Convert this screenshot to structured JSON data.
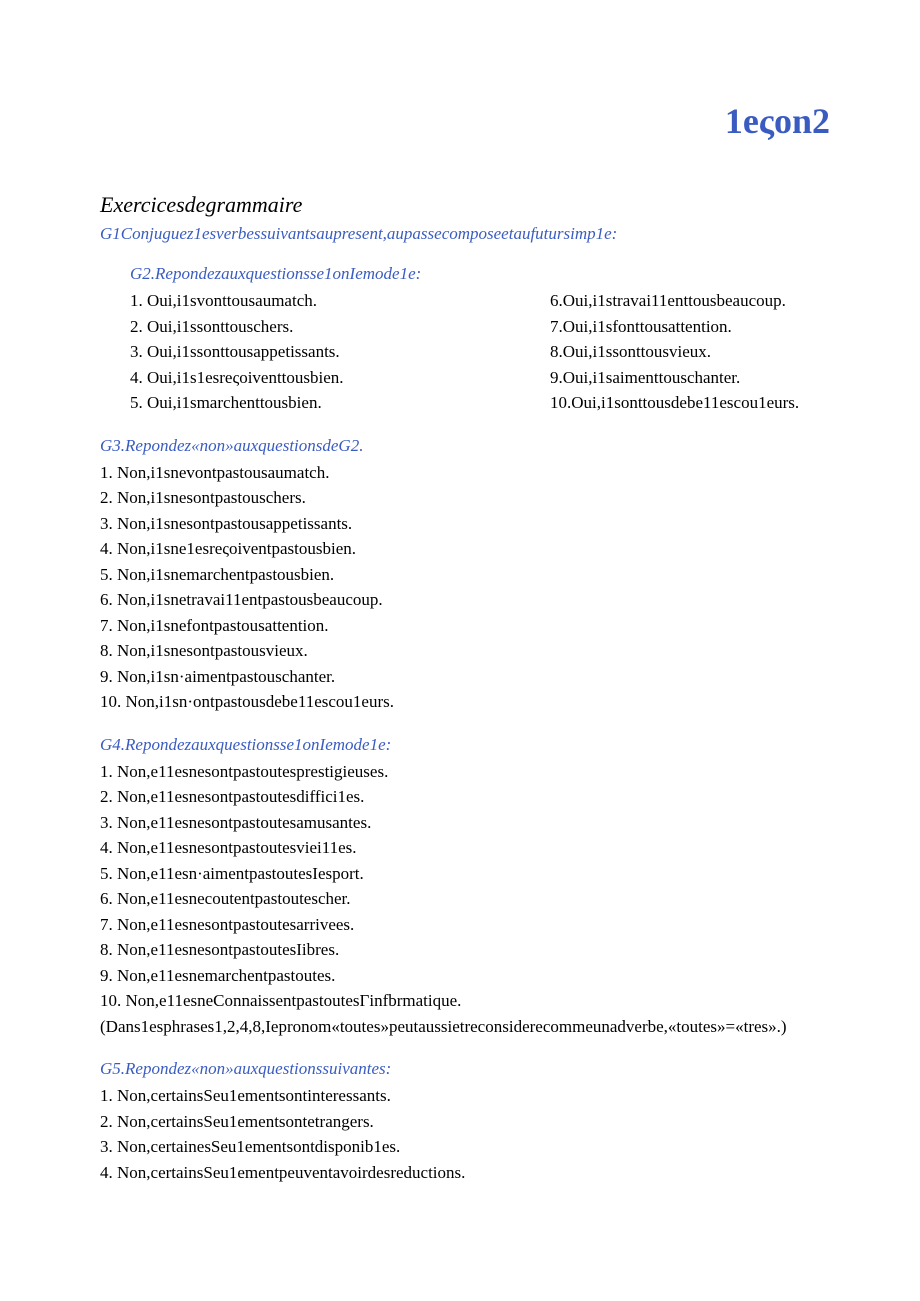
{
  "title": "1eςon2",
  "heading": "Exercicesdegrammaire",
  "g1": "G1Conjuguez1esverbessuivantsaupresent,aupassecomposeetaufutursimp1e:",
  "g2": {
    "title": "G2.Repondezauxquestionsse1onIemode1e:",
    "left": [
      "1.  Oui,i1svonttousaumatch.",
      "2.  Oui,i1ssonttouschers.",
      "3.  Oui,i1ssonttousappetissants.",
      "4.  Oui,i1s1esreςoiventtousbien.",
      "5.  Oui,i1smarchenttousbien."
    ],
    "right": [
      "6.Oui,i1stravai11enttousbeaucoup.",
      "7.Oui,i1sfonttousattention.",
      "8.Oui,i1ssonttousvieux.",
      "9.Oui,i1saimenttouschanter.",
      "10.Oui,i1sonttousdebe11escou1eurs."
    ]
  },
  "g3": {
    "title": "G3.Repondez«non»auxquestionsdeG2.",
    "items": [
      "1.  Non,i1snevontpastousaumatch.",
      "2.  Non,i1snesontpastouschers.",
      "3.  Non,i1snesontpastousappetissants.",
      "4.  Non,i1sne1esreςoiventpastousbien.",
      "5.  Non,i1snemarchentpastousbien.",
      "6.  Non,i1snetravai11entpastousbeaucoup.",
      "7.  Non,i1snefontpastousattention.",
      "8.  Non,i1snesontpastousvieux.",
      "9.  Non,i1sn·aimentpastouschanter.",
      "10.   Non,i1sn·ontpastousdebe11escou1eurs."
    ]
  },
  "g4": {
    "title": "G4.Repondezauxquestionsse1onIemode1e:",
    "items": [
      "1.  Non,e11esnesontpastoutesprestigieuses.",
      "2.  Non,e11esnesontpastoutesdiffici1es.",
      "3.  Non,e11esnesontpastoutesamusantes.",
      "4.  Non,e11esnesontpastoutesviei11es.",
      "5.  Non,e11esn·aimentpastoutesIesport.",
      "6.  Non,e11esnecoutentpastoutescher.",
      "7.  Non,e11esnesontpastoutesarrivees.",
      "8.  Non,e11esnesontpastoutesIibres.",
      "9.  Non,e11esnemarchentpastoutes.",
      "10.   Non,e11esneConnaissentpastoutesΓinfbrmatique."
    ],
    "note": "(Dans1esphrases1,2,4,8,Iepronom«toutes»peutaussietreconsiderecommeunadverbe,«toutes»=«tres».)"
  },
  "g5": {
    "title": "G5.Repondez«non»auxquestionssuivantes:",
    "items": [
      "1.  Non,certainsSeu1ementsontinteressants.",
      "2.  Non,certainsSeu1ementsontetrangers.",
      "3.  Non,certainesSeu1ementsontdisponib1es.",
      "4.  Non,certainsSeu1ementpeuventavoirdesreductions."
    ]
  }
}
